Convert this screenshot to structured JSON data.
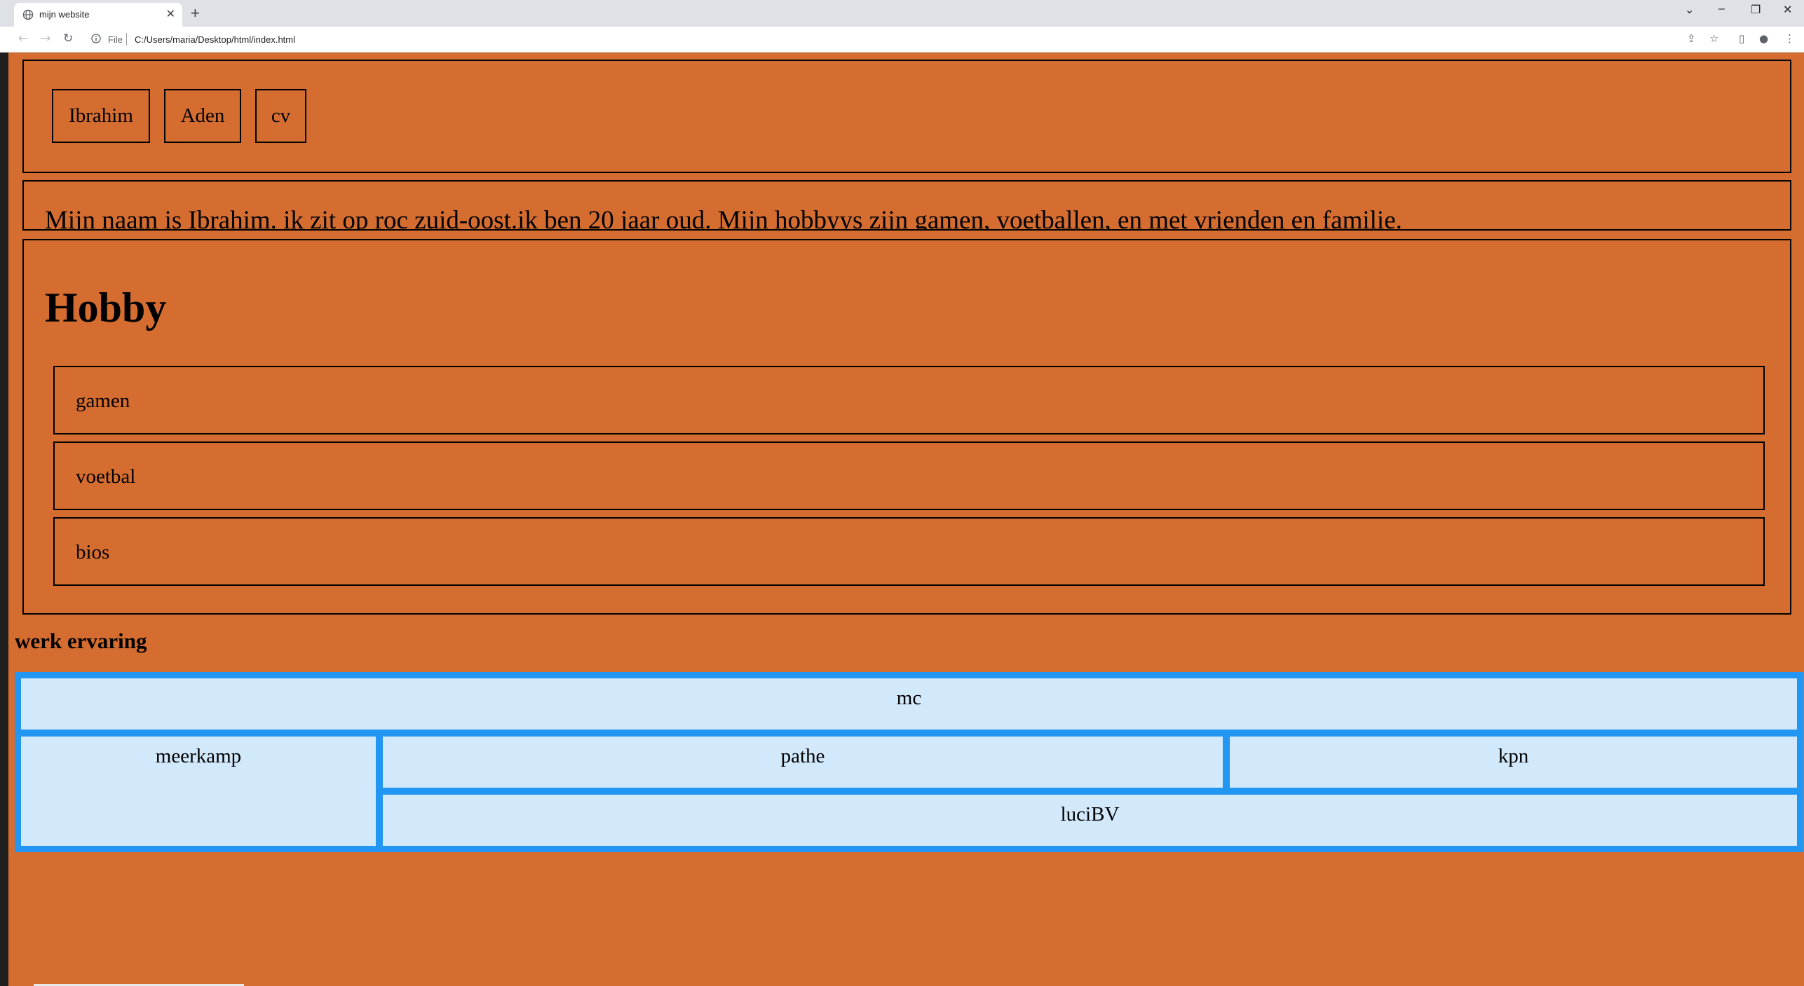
{
  "browser": {
    "tab_title": "mijn website",
    "new_tab_symbol": "+",
    "tab_close_symbol": "✕",
    "address_scheme": "File",
    "address_url": "C:/Users/maria/Desktop/html/index.html",
    "window_controls": {
      "tabsearch": "⌄",
      "minimize": "–",
      "restore": "❐",
      "close": "✕"
    },
    "nav": {
      "back": "←",
      "forward": "→",
      "reload": "↻"
    },
    "toolbar_icons": {
      "share": "⇪",
      "bookmark": "☆",
      "sidepanel": "▯",
      "profile": "●",
      "menu": "⋮"
    }
  },
  "nav_buttons": [
    "Ibrahim",
    "Aden",
    "cv"
  ],
  "intro_text": "Mijn naam is Ibrahim. ik zit op roc zuid-oost.ik ben 20 jaar oud. Mijn hobbyys zijn gamen, voetballen, en met vrienden en familie.",
  "hobby": {
    "title": "Hobby",
    "items": [
      "gamen",
      "voetbal",
      "bios"
    ]
  },
  "werk": {
    "title": "werk ervaring",
    "cells": {
      "top": "mc",
      "left": "meerkamp",
      "middle": "pathe",
      "right": "kpn",
      "bottom": "luciBV"
    }
  },
  "colors": {
    "page_background": "#d56d31",
    "grid_border": "#2196f3",
    "grid_cell": "#d2e8fb"
  }
}
